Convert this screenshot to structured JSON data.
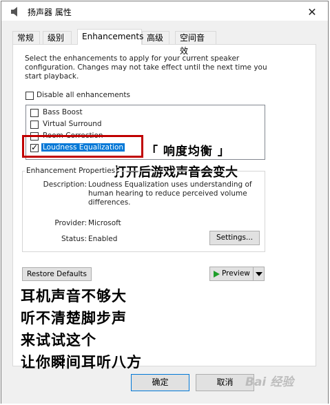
{
  "window": {
    "title": "扬声器 属性"
  },
  "tabs": [
    {
      "label": "常规"
    },
    {
      "label": "级别"
    },
    {
      "label": "Enhancements"
    },
    {
      "label": "高级"
    },
    {
      "label": "空间音效"
    }
  ],
  "enhancements": {
    "description": "Select the enhancements to apply for your current speaker configuration. Changes may not take effect until the next time you start playback.",
    "disable_all_label": "Disable all enhancements",
    "items": [
      {
        "label": "Bass Boost",
        "checked": false
      },
      {
        "label": "Virtual Surround",
        "checked": false
      },
      {
        "label": "Room Correction",
        "checked": false
      },
      {
        "label": "Loudness Equalization",
        "checked": true
      }
    ]
  },
  "properties": {
    "legend": "Enhancement Properties",
    "description_label": "Description:",
    "description_value": "Loudness Equalization uses understanding of human hearing to reduce perceived volume differences.",
    "provider_label": "Provider:",
    "provider_value": "Microsoft",
    "status_label": "Status:",
    "status_value": "Enabled",
    "settings_button": "Settings..."
  },
  "buttons": {
    "restore_defaults": "Restore Defaults",
    "preview": "Preview",
    "ok": "确定",
    "cancel": "取消"
  },
  "annotations": {
    "title": "「 响度均衡 」",
    "subtitle": "打开后游戏声音会变大",
    "lines": [
      "耳机声音不够大",
      "听不清楚脚步声",
      "来试试这个",
      "让你瞬间耳听八方"
    ]
  },
  "watermark": "Bai 经验",
  "colors": {
    "highlight": "#0078d7",
    "annotation_box": "#c00000",
    "play": "#1e9e2a"
  }
}
